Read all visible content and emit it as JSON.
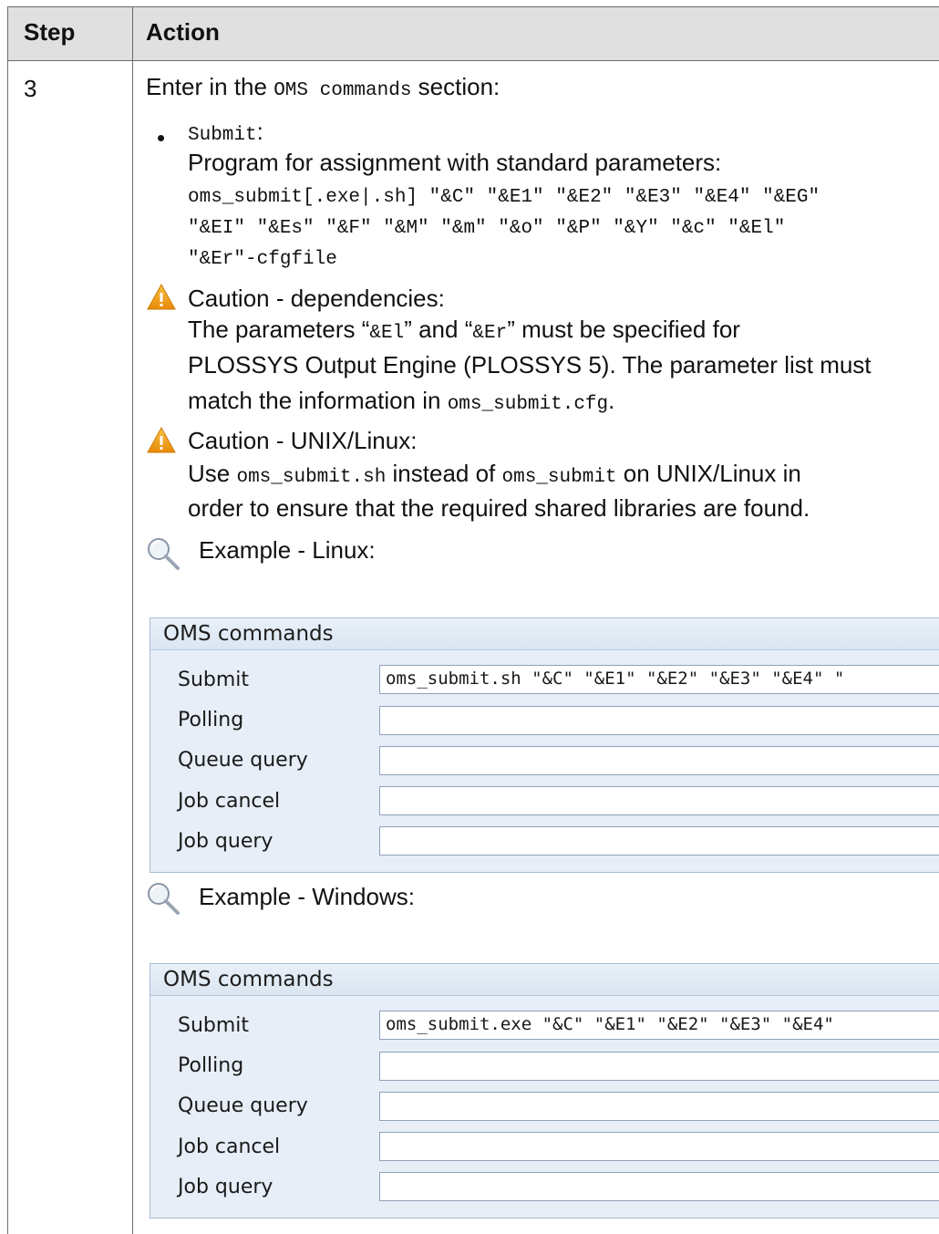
{
  "table": {
    "headers": {
      "step": "Step",
      "action": "Action"
    },
    "step_number": "3"
  },
  "intro": {
    "prefix": "Enter in the ",
    "code": "OMS commands",
    "suffix": " section:"
  },
  "bullet": {
    "symbol": "•",
    "label_code": "Submit",
    "label_suffix": ":",
    "description": "Program for assignment with standard parameters:",
    "code_lines": [
      "oms_submit[.exe|.sh] \"&C\" \"&E1\" \"&E2\" \"&E3\" \"&E4\" \"&EG\"",
      "\"&EI\" \"&Es\" \"&F\" \"&M\" \"&m\" \"&o\" \"&P\" \"&Y\" \"&c\" \"&El\"",
      "\"&Er\"-cfgfile"
    ]
  },
  "caution_dependencies": {
    "title": "Caution - dependencies:",
    "line1_a": "The parameters “",
    "line1_code1": "&El",
    "line1_b": "” and “",
    "line1_code2": "&Er",
    "line1_c": "” must be specified for",
    "line2": "PLOSSYS Output Engine (PLOSSYS 5). The parameter list must",
    "line3_a": "match the information in ",
    "line3_code": "oms_submit.cfg",
    "line3_b": "."
  },
  "caution_unix": {
    "title": "Caution - UNIX/Linux:",
    "line1_a": "Use ",
    "line1_code1": "oms_submit.sh",
    "line1_b": " instead of ",
    "line1_code2": "oms_submit",
    "line1_c": " on UNIX/Linux in",
    "line2": "order to ensure that the required shared libraries are found."
  },
  "example_linux": {
    "title": "Example - Linux:",
    "panel_title": "OMS commands",
    "rows": [
      {
        "label": "Submit",
        "value": "oms_submit.sh \"&C\" \"&E1\" \"&E2\" \"&E3\" \"&E4\" \""
      },
      {
        "label": "Polling",
        "value": ""
      },
      {
        "label": "Queue query",
        "value": ""
      },
      {
        "label": "Job cancel",
        "value": ""
      },
      {
        "label": "Job query",
        "value": ""
      }
    ]
  },
  "example_windows": {
    "title": "Example - Windows:",
    "panel_title": "OMS commands",
    "rows": [
      {
        "label": "Submit",
        "value": "oms_submit.exe \"&C\" \"&E1\" \"&E2\" \"&E3\" \"&E4\""
      },
      {
        "label": "Polling",
        "value": ""
      },
      {
        "label": "Queue query",
        "value": ""
      },
      {
        "label": "Job cancel",
        "value": ""
      },
      {
        "label": "Job query",
        "value": ""
      }
    ]
  },
  "icons": {
    "caution": "warning-triangle-icon",
    "example": "magnifier-icon",
    "caution_color": "#f0a30a",
    "panel_bg": "#e7eef7"
  }
}
